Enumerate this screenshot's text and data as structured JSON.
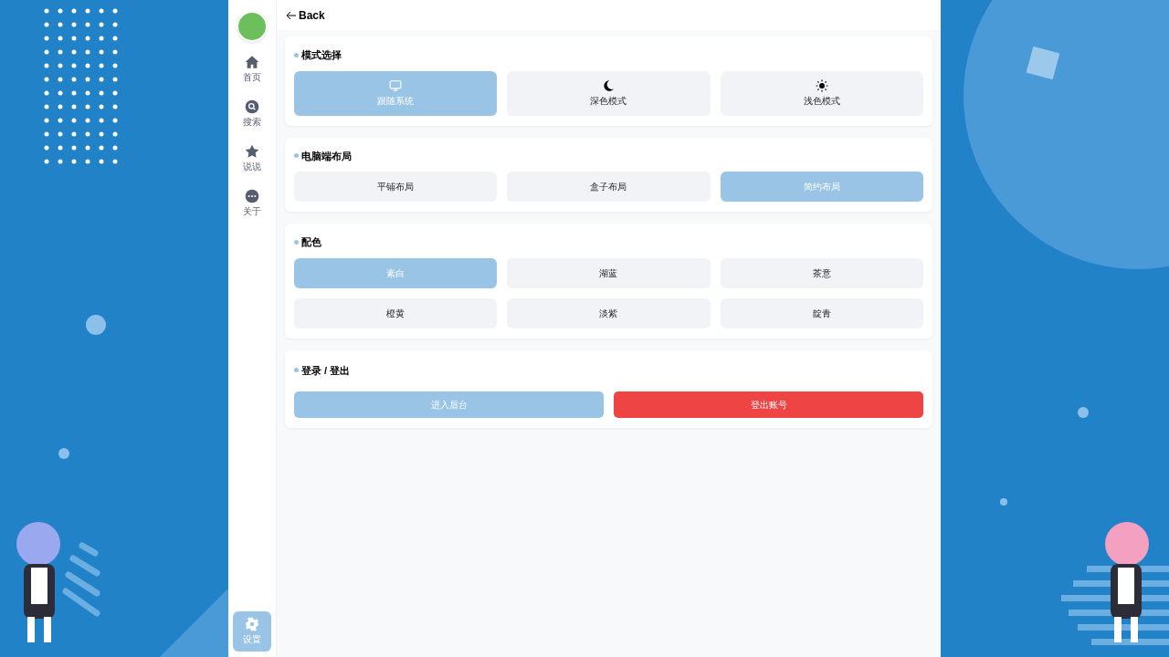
{
  "sidebar": {
    "items": [
      {
        "label": "首页",
        "selected": false
      },
      {
        "label": "搜索",
        "selected": false
      },
      {
        "label": "说说",
        "selected": false
      },
      {
        "label": "关于",
        "selected": false
      },
      {
        "label": "设置",
        "selected": true
      }
    ]
  },
  "header": {
    "back": "Back"
  },
  "sections": [
    {
      "title": "模式选择",
      "kind": "icon-choices",
      "options": [
        {
          "label": "跟随系统",
          "selected": true
        },
        {
          "label": "深色模式",
          "selected": false
        },
        {
          "label": "浅色模式",
          "selected": false
        }
      ]
    },
    {
      "title": "电脑端布局",
      "kind": "choices",
      "options": [
        {
          "label": "平铺布局",
          "selected": false
        },
        {
          "label": "盒子布局",
          "selected": false
        },
        {
          "label": "简约布局",
          "selected": true
        }
      ]
    },
    {
      "title": "配色",
      "kind": "choices",
      "options": [
        {
          "label": "素白",
          "selected": true
        },
        {
          "label": "湖蓝",
          "selected": false
        },
        {
          "label": "茶意",
          "selected": false
        },
        {
          "label": "橙黄",
          "selected": false
        },
        {
          "label": "淡紫",
          "selected": false
        },
        {
          "label": "靛青",
          "selected": false
        }
      ]
    },
    {
      "title": "登录 / 登出",
      "kind": "actions",
      "buttons": [
        {
          "label": "进入后台",
          "kind": "primary"
        },
        {
          "label": "登出账号",
          "kind": "danger"
        }
      ]
    }
  ]
}
